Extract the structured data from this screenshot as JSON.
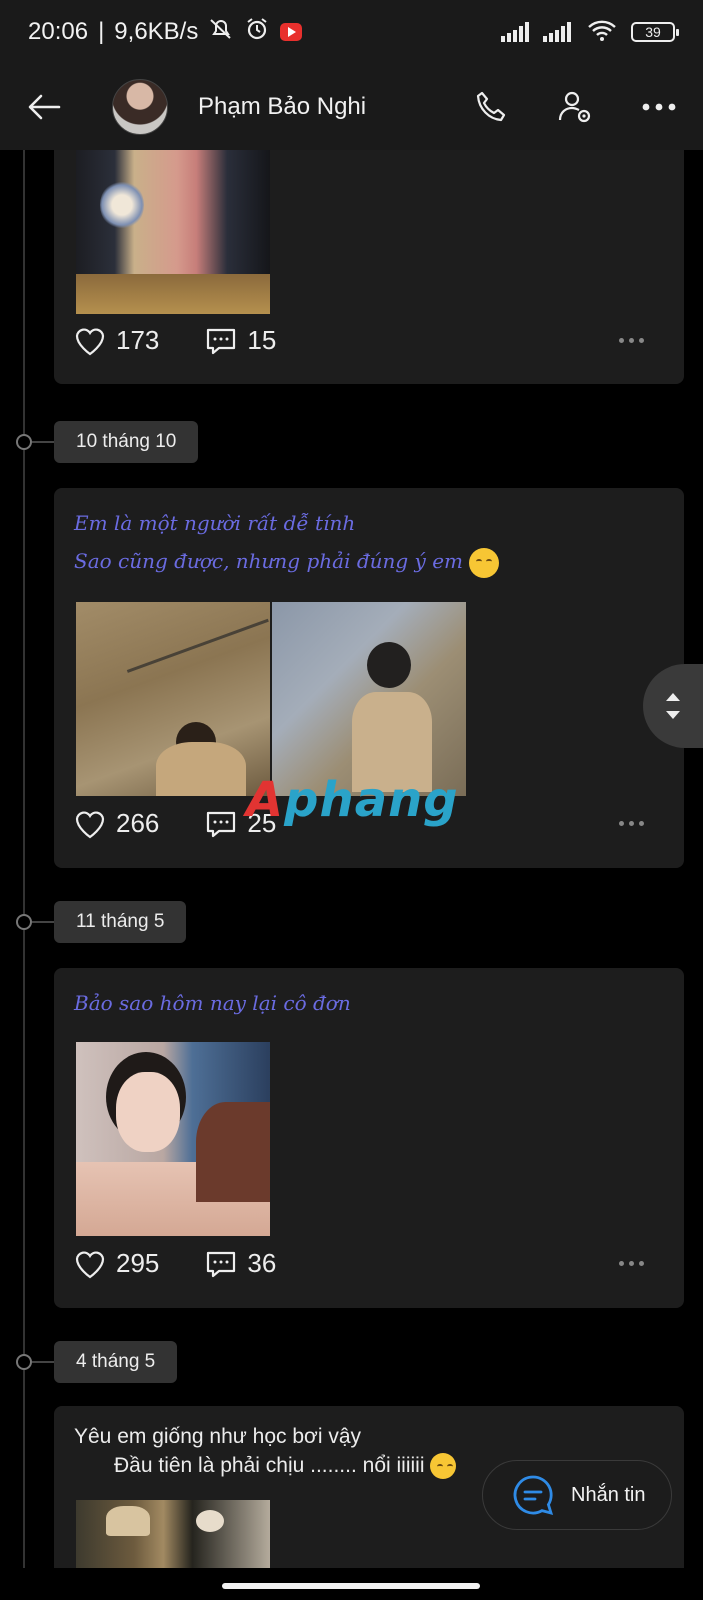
{
  "status_bar": {
    "time": "20:06",
    "network_speed": "9,6KB/s",
    "battery": "39",
    "icons": [
      "mute-icon",
      "alarm-icon",
      "youtube-icon",
      "signal-icon",
      "signal-icon",
      "wifi-icon",
      "battery-icon"
    ]
  },
  "header": {
    "contact_name": "Phạm Bảo Nghi",
    "icons": [
      "back-arrow-icon",
      "phone-icon",
      "user-settings-icon",
      "more-icon"
    ]
  },
  "posts": [
    {
      "date": "",
      "caption_lines": [],
      "likes": "173",
      "comments": "15"
    },
    {
      "date": "10 tháng 10",
      "caption_lines": [
        "Em là một người rất dễ tính",
        "Sao cũng được, nhưng phải đúng ý em"
      ],
      "caption_emoji": "relieved-face-emoji",
      "likes": "266",
      "comments": "25"
    },
    {
      "date": "11 tháng 5",
      "caption_lines": [
        "Bảo sao hôm nay lại cô đơn"
      ],
      "likes": "295",
      "comments": "36"
    },
    {
      "date": "4 tháng 5",
      "caption_lines": [
        "Yêu em giống như học bơi vậy",
        "Đầu tiên là phải chịu ........ nổi iiiiii"
      ],
      "caption_emoji": "hand-over-mouth-emoji"
    }
  ],
  "fab": {
    "message_label": "Nhắn tin"
  },
  "watermark": {
    "part1": "A",
    "part2": "phang"
  },
  "colors": {
    "accent_blue": "#2f8be6",
    "script_text": "#6a6be0",
    "card_bg": "#1d1d1d"
  }
}
